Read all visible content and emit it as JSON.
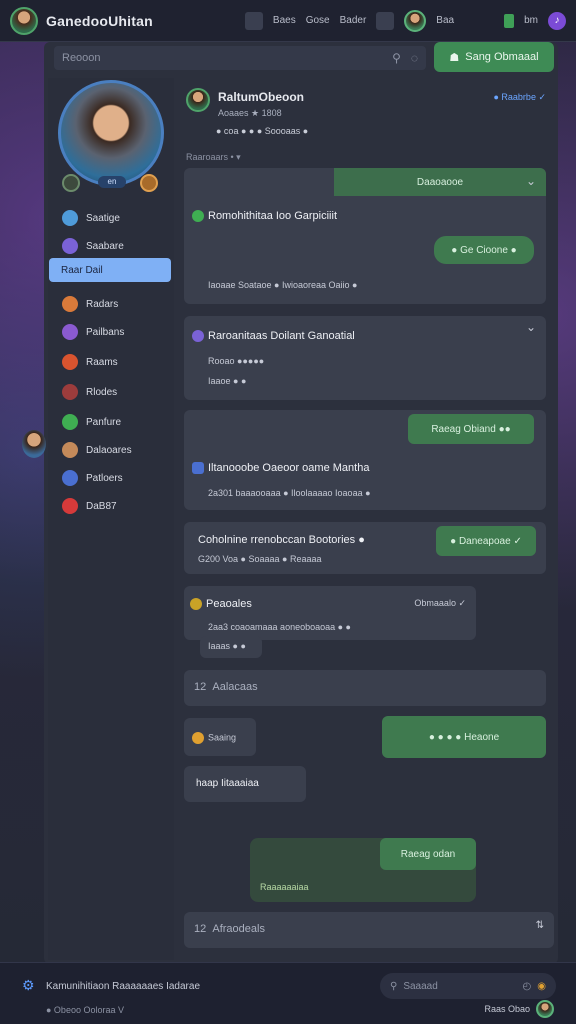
{
  "topbar": {
    "title": "GanedooUhitan",
    "nav": [
      "Baes",
      "Gose",
      "Bader",
      "Baa"
    ],
    "right_label": "Baa",
    "badge_label": "bm"
  },
  "search": {
    "placeholder": "Reooon"
  },
  "cta": {
    "label": "Sang Obmaaal"
  },
  "sidebar": {
    "items": [
      {
        "label": "Saatige",
        "color": "#4f9bd9"
      },
      {
        "label": "Saabare",
        "color": "#7a62d6"
      },
      {
        "label": "Raar Dail",
        "color": "#7fb0f5"
      },
      {
        "label": "Radars",
        "color": "#d97a3a"
      },
      {
        "label": "Pailbans",
        "color": "#8a5ad0"
      },
      {
        "label": "Raams",
        "color": "#d9542f"
      },
      {
        "label": "Rlodes",
        "color": "#9c3c3c"
      },
      {
        "label": "Panfure",
        "color": "#3fae52"
      },
      {
        "label": "Dalaoares",
        "color": "#c48a5a"
      },
      {
        "label": "Patloers",
        "color": "#4a6fd0"
      },
      {
        "label": "DaB87",
        "color": "#d63a3a"
      }
    ]
  },
  "post": {
    "author": "RaltumObeoon",
    "sub": "Aoaaes ★ 1808",
    "emojis": "● coa  ●  ●  ●  Soooaas ●",
    "verify": "● Raabrbe ✓",
    "sort": "Raaroaars • ▾"
  },
  "cards": [
    {
      "pill": "Daaoaooe",
      "title": "Romohithitaa Ioo Garpiciiit",
      "btn": "● Ge Cioone ●",
      "meta": "Iaoaae  Soataoe ●  Iwioaoreaa Oaiio ●"
    },
    {
      "title": "Raroanitaas Doilant Ganoatial",
      "meta1": "Rooao ●●●●●",
      "meta2": "Iaaoe ● ●"
    },
    {
      "btn": "Raeag Obiand ●●",
      "title": "Iltanooobe Oaeoor oame Mantha",
      "meta": "2a301  baaaooaaa  ● Iloolaaaao  Ioaoaa ●"
    },
    {
      "title": "Coholnine rrenobccan Bootories ●",
      "meta": "G200 Voa  ● Soaaaa  ● Reaaaa",
      "btn": "● Daneapoae ✓"
    },
    {
      "title": "Peaoales",
      "right": "Obmaaalo ✓",
      "meta": "2aa3  coaoamaaa aoneoboaoaa ● ●",
      "sub": "Iaaas ● ●"
    }
  ],
  "section1": "Aalacaas",
  "section1_num": "12",
  "saaring": "Saaing",
  "react_pill": "● ● ● ●  Heaone",
  "happy": "haap Iitaaaiaa",
  "bottom_pill": "Raeag odan",
  "bottom_meta": "Raaaaaaiaa",
  "section2": "Afraodeals",
  "section2_num": "12",
  "footer": {
    "text": "Kamunihitiaon Raaaaaaes Iadarae",
    "sub": "● Obeoo Ooloraa V",
    "search": "Saaaad",
    "right": "Raas Obao"
  },
  "colors": {
    "accent_green": "#3e8b55",
    "accent_blue": "#7fb0f5",
    "panel": "#3a3f4d"
  }
}
